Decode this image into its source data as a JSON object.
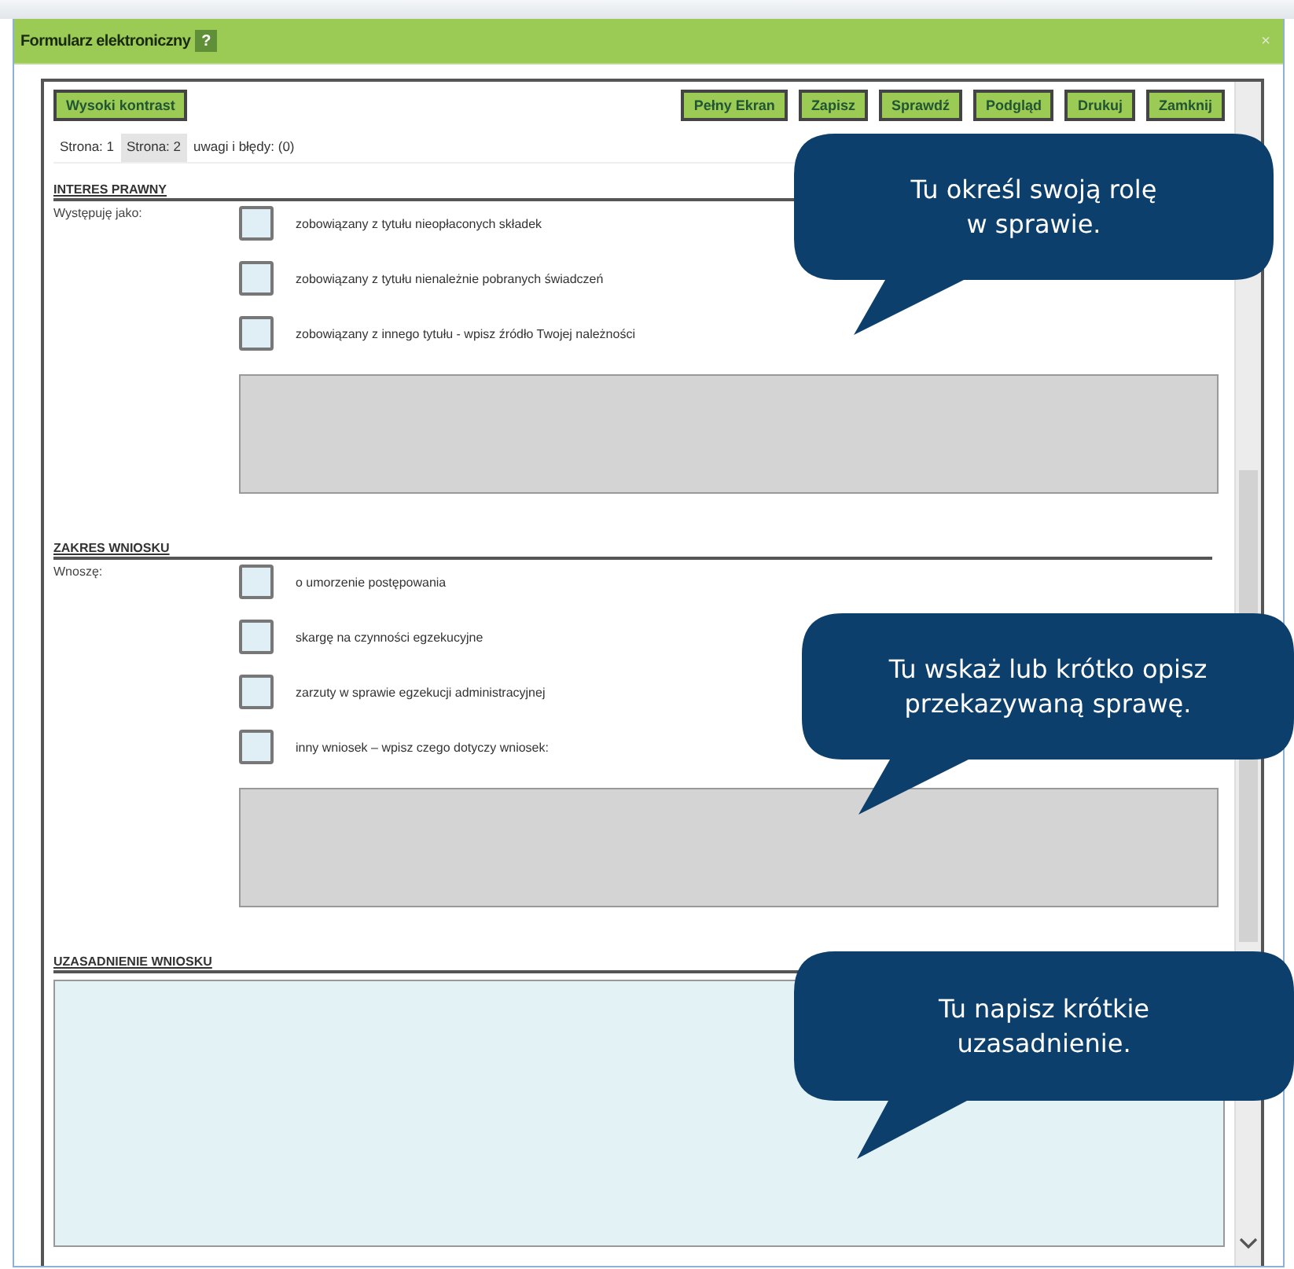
{
  "window": {
    "title": "Formularz elektroniczny",
    "help": "?",
    "close": "×"
  },
  "toolbar": {
    "left_button": "Wysoki kontrast",
    "buttons": [
      "Pełny Ekran",
      "Zapisz",
      "Sprawdź",
      "Podgląd",
      "Drukuj",
      "Zamknij"
    ]
  },
  "tabs": [
    {
      "label": "Strona: 1",
      "selected": false
    },
    {
      "label": "Strona: 2",
      "selected": true
    },
    {
      "label": "uwagi i błędy: (0)",
      "selected": false
    }
  ],
  "sections": [
    {
      "heading": "INTERES PRAWNY",
      "label": "Występuję jako:",
      "options": [
        {
          "text": "zobowiązany z tytułu nieopłaconych składek",
          "checked": false
        },
        {
          "text": "zobowiązany z tytułu nienależnie pobranych świadczeń",
          "checked": false
        },
        {
          "text": "zobowiązany z innego tytułu - wpisz źródło Twojej należności",
          "checked": false
        }
      ],
      "textarea": true
    },
    {
      "heading": "ZAKRES WNIOSKU",
      "label": "Wnoszę:",
      "options": [
        {
          "text": "o umorzenie postępowania",
          "checked": false
        },
        {
          "text": "skargę na czynności egzekucyjne",
          "checked": false
        },
        {
          "text": "zarzuty w sprawie egzekucji administracyjnej",
          "checked": false
        },
        {
          "text": "inny wniosek – wpisz czego dotyczy wniosek:",
          "checked": false
        }
      ],
      "textarea": true
    },
    {
      "heading": "UZASADNIENIE WNIOSKU",
      "big_textarea": true
    }
  ],
  "callouts": [
    {
      "lines": [
        "Tu określ swoją rolę",
        "w sprawie."
      ]
    },
    {
      "lines": [
        "Tu wskaż lub krótko opisz",
        "przekazywaną sprawę."
      ]
    },
    {
      "lines": [
        "Tu napisz krótkie",
        "uzasadnienie."
      ]
    }
  ]
}
